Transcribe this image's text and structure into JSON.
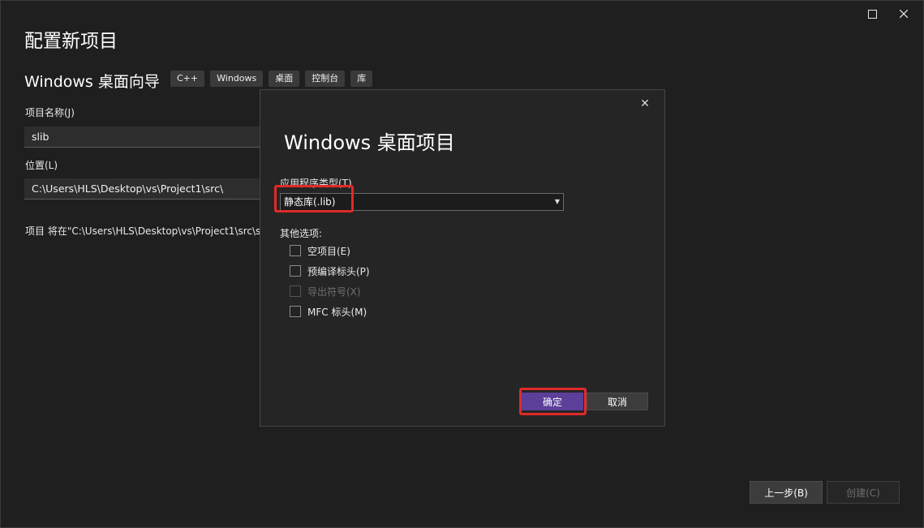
{
  "window": {
    "title": "配置新项目"
  },
  "header": {
    "subtitle": "Windows 桌面向导",
    "tags": [
      "C++",
      "Windows",
      "桌面",
      "控制台",
      "库"
    ]
  },
  "form": {
    "project_name_label": "项目名称(J)",
    "project_name_value": "slib",
    "location_label": "位置(L)",
    "location_value": "C:\\Users\\HLS\\Desktop\\vs\\Project1\\src\\",
    "path_note": "项目 将在\"C:\\Users\\HLS\\Desktop\\vs\\Project1\\src\\slib\\\"中创建"
  },
  "footer": {
    "back_label": "上一步(B)",
    "create_label": "创建(C)"
  },
  "dialog": {
    "title": "Windows 桌面项目",
    "app_type_label": "应用程序类型(T)",
    "app_type_value": "静态库(.lib)",
    "other_options_label": "其他选项:",
    "options": [
      {
        "label": "空项目(E)",
        "checked": false,
        "enabled": true
      },
      {
        "label": "预编译标头(P)",
        "checked": false,
        "enabled": true
      },
      {
        "label": "导出符号(X)",
        "checked": false,
        "enabled": false
      },
      {
        "label": "MFC 标头(M)",
        "checked": false,
        "enabled": true
      }
    ],
    "ok_label": "确定",
    "cancel_label": "取消",
    "close_glyph": "✕"
  },
  "colors": {
    "accent": "#5b3f99",
    "highlight": "#e02a2a",
    "background": "#1f1f1f"
  }
}
